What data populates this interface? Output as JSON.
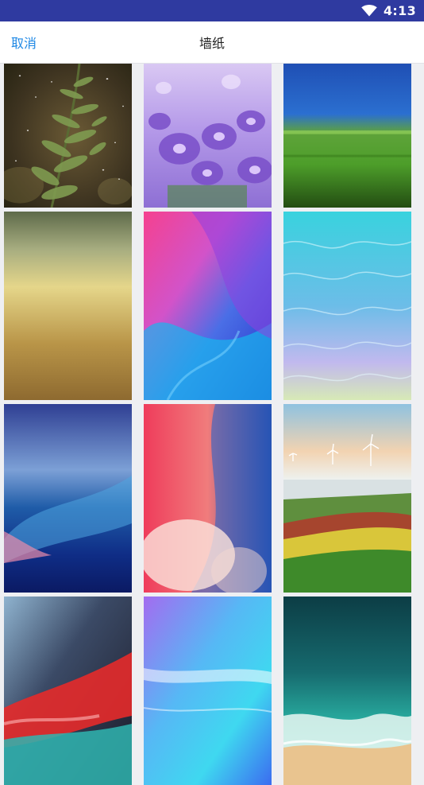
{
  "status_bar": {
    "time": "4:13",
    "icons": [
      "wifi-icon"
    ]
  },
  "toolbar": {
    "cancel_label": "取消",
    "title": "墙纸"
  },
  "accent_colors": {
    "status_bar_bg": "#2f3aa0",
    "cancel_text": "#1e88e5"
  },
  "wallpapers": [
    {
      "theme": "pine-branch-bokeh"
    },
    {
      "theme": "purple-flowers"
    },
    {
      "theme": "blue-green-blur"
    },
    {
      "theme": "olive-gold-gradient"
    },
    {
      "theme": "pink-blue-waves"
    },
    {
      "theme": "turquoise-water"
    },
    {
      "theme": "deep-blue-wave"
    },
    {
      "theme": "red-blue-swirl"
    },
    {
      "theme": "wind-turbines-fields"
    },
    {
      "theme": "red-teal-abstract"
    },
    {
      "theme": "purple-cyan-light"
    },
    {
      "theme": "aerial-ocean-beach"
    }
  ]
}
